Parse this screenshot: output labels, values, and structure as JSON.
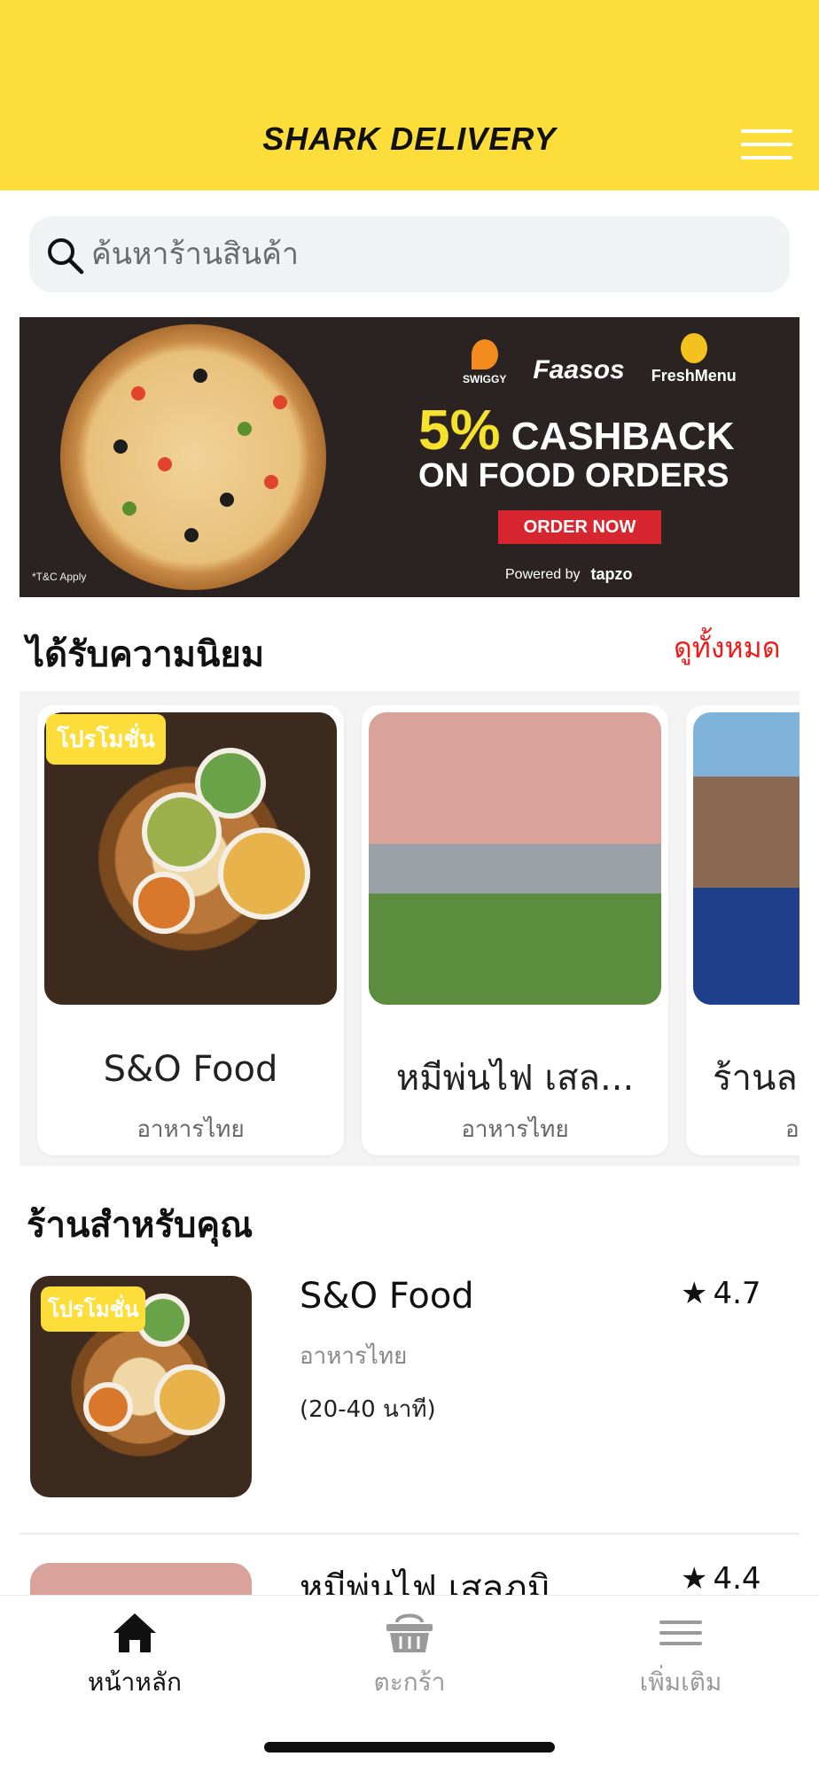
{
  "app": {
    "brand": "SHARK DELIVERY"
  },
  "search": {
    "placeholder": "ค้นหาร้านสินค้า"
  },
  "banner": {
    "partners": [
      "SWIGGY",
      "Faasos",
      "FreshMenu"
    ],
    "percent": "5%",
    "headline_rest": "CASHBACK",
    "headline_line2": "ON FOOD ORDERS",
    "cta": "ORDER NOW",
    "terms": "*T&C Apply",
    "powered_by": "Powered by",
    "powered_brand": "tapzo"
  },
  "popular": {
    "title": "ได้รับความนิยม",
    "see_all": "ดูทั้งหมด",
    "cards": [
      {
        "name": "S&O Food",
        "category": "อาหารไทย",
        "badge": "โปรโมชั่น"
      },
      {
        "name": "หมีพ่นไฟ เสล...",
        "category": "อาหารไทย"
      },
      {
        "name": "ร้านล",
        "category": "อ"
      }
    ]
  },
  "for_you": {
    "title": "ร้านสำหรับคุณ",
    "items": [
      {
        "name": "S&O Food",
        "category": "อาหารไทย",
        "time": "(20-40 นาที)",
        "rating": "4.7",
        "badge": "โปรโมชั่น"
      },
      {
        "name": "หมีพ่นไฟ เสลภูมิ",
        "rating": "4.4"
      }
    ]
  },
  "tabbar": {
    "tabs": [
      {
        "label": "หน้าหลัก",
        "icon": "home-icon",
        "active": true
      },
      {
        "label": "ตะกร้า",
        "icon": "basket-icon",
        "active": false
      },
      {
        "label": "เพิ่มเติม",
        "icon": "menu-icon",
        "active": false
      }
    ]
  },
  "colors": {
    "brand_yellow": "#FDDD3A",
    "accent_red": "#ee1b1b",
    "inactive_gray": "#9a9a9a"
  }
}
